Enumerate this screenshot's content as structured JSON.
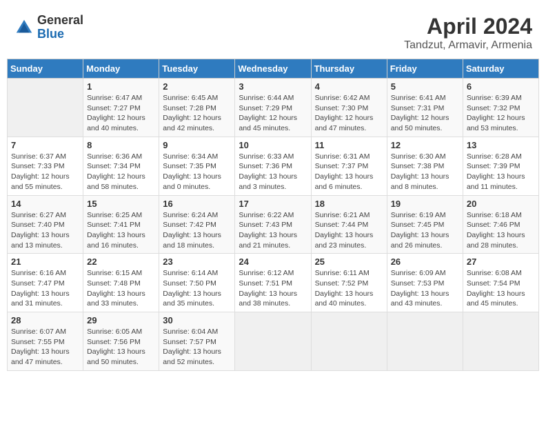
{
  "header": {
    "logo_general": "General",
    "logo_blue": "Blue",
    "month_title": "April 2024",
    "location": "Tandzut, Armavir, Armenia"
  },
  "days_of_week": [
    "Sunday",
    "Monday",
    "Tuesday",
    "Wednesday",
    "Thursday",
    "Friday",
    "Saturday"
  ],
  "weeks": [
    [
      {
        "day": "",
        "content": ""
      },
      {
        "day": "1",
        "content": "Sunrise: 6:47 AM\nSunset: 7:27 PM\nDaylight: 12 hours\nand 40 minutes."
      },
      {
        "day": "2",
        "content": "Sunrise: 6:45 AM\nSunset: 7:28 PM\nDaylight: 12 hours\nand 42 minutes."
      },
      {
        "day": "3",
        "content": "Sunrise: 6:44 AM\nSunset: 7:29 PM\nDaylight: 12 hours\nand 45 minutes."
      },
      {
        "day": "4",
        "content": "Sunrise: 6:42 AM\nSunset: 7:30 PM\nDaylight: 12 hours\nand 47 minutes."
      },
      {
        "day": "5",
        "content": "Sunrise: 6:41 AM\nSunset: 7:31 PM\nDaylight: 12 hours\nand 50 minutes."
      },
      {
        "day": "6",
        "content": "Sunrise: 6:39 AM\nSunset: 7:32 PM\nDaylight: 12 hours\nand 53 minutes."
      }
    ],
    [
      {
        "day": "7",
        "content": "Sunrise: 6:37 AM\nSunset: 7:33 PM\nDaylight: 12 hours\nand 55 minutes."
      },
      {
        "day": "8",
        "content": "Sunrise: 6:36 AM\nSunset: 7:34 PM\nDaylight: 12 hours\nand 58 minutes."
      },
      {
        "day": "9",
        "content": "Sunrise: 6:34 AM\nSunset: 7:35 PM\nDaylight: 13 hours\nand 0 minutes."
      },
      {
        "day": "10",
        "content": "Sunrise: 6:33 AM\nSunset: 7:36 PM\nDaylight: 13 hours\nand 3 minutes."
      },
      {
        "day": "11",
        "content": "Sunrise: 6:31 AM\nSunset: 7:37 PM\nDaylight: 13 hours\nand 6 minutes."
      },
      {
        "day": "12",
        "content": "Sunrise: 6:30 AM\nSunset: 7:38 PM\nDaylight: 13 hours\nand 8 minutes."
      },
      {
        "day": "13",
        "content": "Sunrise: 6:28 AM\nSunset: 7:39 PM\nDaylight: 13 hours\nand 11 minutes."
      }
    ],
    [
      {
        "day": "14",
        "content": "Sunrise: 6:27 AM\nSunset: 7:40 PM\nDaylight: 13 hours\nand 13 minutes."
      },
      {
        "day": "15",
        "content": "Sunrise: 6:25 AM\nSunset: 7:41 PM\nDaylight: 13 hours\nand 16 minutes."
      },
      {
        "day": "16",
        "content": "Sunrise: 6:24 AM\nSunset: 7:42 PM\nDaylight: 13 hours\nand 18 minutes."
      },
      {
        "day": "17",
        "content": "Sunrise: 6:22 AM\nSunset: 7:43 PM\nDaylight: 13 hours\nand 21 minutes."
      },
      {
        "day": "18",
        "content": "Sunrise: 6:21 AM\nSunset: 7:44 PM\nDaylight: 13 hours\nand 23 minutes."
      },
      {
        "day": "19",
        "content": "Sunrise: 6:19 AM\nSunset: 7:45 PM\nDaylight: 13 hours\nand 26 minutes."
      },
      {
        "day": "20",
        "content": "Sunrise: 6:18 AM\nSunset: 7:46 PM\nDaylight: 13 hours\nand 28 minutes."
      }
    ],
    [
      {
        "day": "21",
        "content": "Sunrise: 6:16 AM\nSunset: 7:47 PM\nDaylight: 13 hours\nand 31 minutes."
      },
      {
        "day": "22",
        "content": "Sunrise: 6:15 AM\nSunset: 7:48 PM\nDaylight: 13 hours\nand 33 minutes."
      },
      {
        "day": "23",
        "content": "Sunrise: 6:14 AM\nSunset: 7:50 PM\nDaylight: 13 hours\nand 35 minutes."
      },
      {
        "day": "24",
        "content": "Sunrise: 6:12 AM\nSunset: 7:51 PM\nDaylight: 13 hours\nand 38 minutes."
      },
      {
        "day": "25",
        "content": "Sunrise: 6:11 AM\nSunset: 7:52 PM\nDaylight: 13 hours\nand 40 minutes."
      },
      {
        "day": "26",
        "content": "Sunrise: 6:09 AM\nSunset: 7:53 PM\nDaylight: 13 hours\nand 43 minutes."
      },
      {
        "day": "27",
        "content": "Sunrise: 6:08 AM\nSunset: 7:54 PM\nDaylight: 13 hours\nand 45 minutes."
      }
    ],
    [
      {
        "day": "28",
        "content": "Sunrise: 6:07 AM\nSunset: 7:55 PM\nDaylight: 13 hours\nand 47 minutes."
      },
      {
        "day": "29",
        "content": "Sunrise: 6:05 AM\nSunset: 7:56 PM\nDaylight: 13 hours\nand 50 minutes."
      },
      {
        "day": "30",
        "content": "Sunrise: 6:04 AM\nSunset: 7:57 PM\nDaylight: 13 hours\nand 52 minutes."
      },
      {
        "day": "",
        "content": ""
      },
      {
        "day": "",
        "content": ""
      },
      {
        "day": "",
        "content": ""
      },
      {
        "day": "",
        "content": ""
      }
    ]
  ]
}
